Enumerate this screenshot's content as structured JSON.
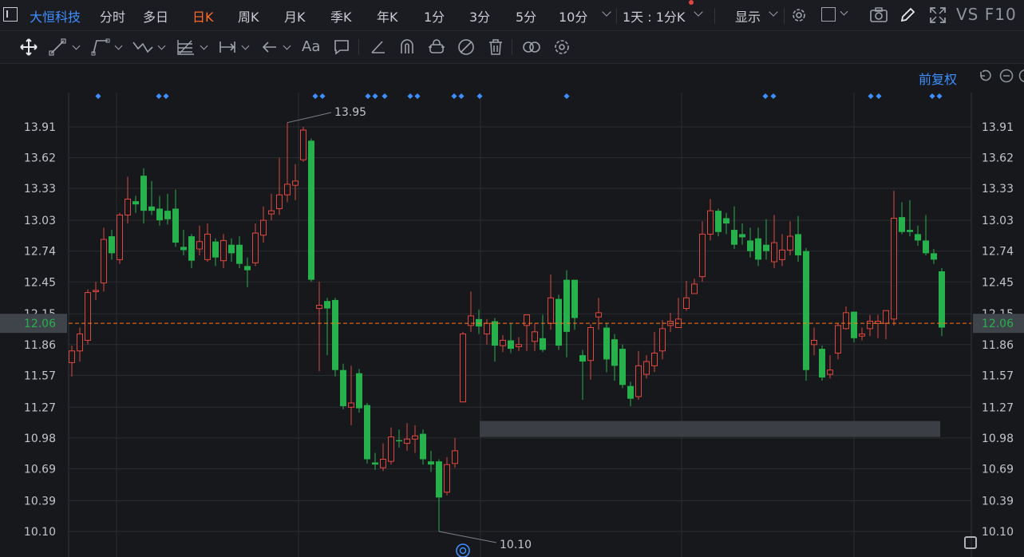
{
  "app": {
    "title": "大恒科技"
  },
  "topbar": {
    "menu_icon": "menu-square-icon",
    "periods": [
      "分时",
      "多日",
      "日K",
      "周K",
      "月K",
      "季K",
      "年K",
      "1分",
      "3分",
      "5分",
      "10分"
    ],
    "active_period": "日K",
    "more_chevron": "chevron-down-icon",
    "range_label": "1天 : 1分K",
    "display_label": "显示",
    "right_text": "VS F10"
  },
  "toolbar": {
    "tools": [
      "move-icon",
      "line-icon",
      "channel-icon",
      "wave-icon",
      "fib-icon",
      "measure-icon",
      "arrow-icon",
      "text-icon",
      "note-icon",
      "angle-icon",
      "magnet-icon",
      "lock-icon",
      "hide-icon",
      "delete-icon",
      "link-icon",
      "settings-icon"
    ],
    "text_tool_label": "Aa"
  },
  "chart_header": {
    "adjust_label": "前复权"
  },
  "colors": {
    "up": "#e0473f",
    "down": "#27b14c",
    "accent": "#3e8fff",
    "bg": "#17181c",
    "grid": "#2a2c31"
  },
  "chart_data": {
    "type": "candlestick",
    "y_ticks": [
      "13.91",
      "13.62",
      "13.33",
      "13.03",
      "12.74",
      "12.45",
      "12.15",
      "11.86",
      "11.57",
      "11.27",
      "10.98",
      "10.69",
      "10.39",
      "10.10"
    ],
    "y_tick_values": [
      13.91,
      13.62,
      13.33,
      13.03,
      12.74,
      12.45,
      12.15,
      11.86,
      11.57,
      11.27,
      10.98,
      10.69,
      10.39,
      10.1
    ],
    "ylim": [
      10.1,
      13.91
    ],
    "current_price": "12.06",
    "current_price_value": 12.06,
    "high_label": "13.95",
    "high_value": 13.95,
    "low_label": "10.10",
    "low_value": 10.1,
    "candles": [
      [
        11.69,
        11.8,
        11.56,
        11.85
      ],
      [
        11.8,
        11.96,
        11.7,
        12.02
      ],
      [
        11.9,
        12.35,
        11.86,
        12.38
      ],
      [
        12.36,
        12.37,
        12.28,
        12.45
      ],
      [
        12.44,
        12.85,
        12.36,
        12.96
      ],
      [
        12.88,
        12.72,
        12.66,
        12.94
      ],
      [
        12.66,
        13.08,
        12.62,
        13.1
      ],
      [
        13.08,
        13.23,
        13.0,
        13.44
      ],
      [
        13.21,
        13.18,
        13.1,
        13.26
      ],
      [
        13.45,
        13.12,
        13.0,
        13.52
      ],
      [
        13.16,
        13.12,
        13.08,
        13.4
      ],
      [
        13.14,
        13.03,
        12.98,
        13.26
      ],
      [
        13.12,
        13.04,
        12.99,
        13.28
      ],
      [
        13.14,
        12.82,
        12.78,
        13.32
      ],
      [
        12.78,
        12.75,
        12.7,
        12.94
      ],
      [
        12.88,
        12.65,
        12.58,
        12.9
      ],
      [
        12.76,
        12.83,
        12.7,
        12.98
      ],
      [
        12.66,
        12.9,
        12.64,
        13.0
      ],
      [
        12.83,
        12.68,
        12.6,
        12.86
      ],
      [
        12.65,
        12.84,
        12.58,
        12.9
      ],
      [
        12.8,
        12.72,
        12.64,
        12.86
      ],
      [
        12.8,
        12.62,
        12.58,
        12.88
      ],
      [
        12.6,
        12.56,
        12.4,
        12.68
      ],
      [
        12.63,
        12.91,
        12.6,
        13.0
      ],
      [
        12.89,
        13.03,
        12.82,
        13.16
      ],
      [
        13.09,
        13.12,
        13.03,
        13.28
      ],
      [
        13.14,
        13.27,
        13.08,
        13.62
      ],
      [
        13.27,
        13.37,
        13.2,
        13.95
      ],
      [
        13.36,
        13.4,
        13.22,
        13.56
      ],
      [
        13.6,
        13.88,
        13.58,
        13.91
      ],
      [
        13.78,
        12.47,
        12.45,
        13.8
      ],
      [
        12.2,
        12.23,
        11.61,
        12.45
      ],
      [
        12.27,
        12.2,
        11.76,
        12.3
      ],
      [
        12.28,
        11.62,
        11.56,
        12.3
      ],
      [
        11.62,
        11.28,
        11.25,
        11.68
      ],
      [
        11.27,
        11.31,
        11.1,
        11.66
      ],
      [
        11.59,
        11.26,
        11.22,
        11.63
      ],
      [
        11.29,
        10.78,
        10.74,
        11.31
      ],
      [
        10.75,
        10.73,
        10.68,
        10.84
      ],
      [
        10.7,
        10.78,
        10.67,
        10.93
      ],
      [
        10.76,
        10.99,
        10.73,
        11.08
      ],
      [
        10.96,
        10.95,
        10.89,
        11.06
      ],
      [
        10.93,
        10.97,
        10.86,
        11.12
      ],
      [
        10.97,
        11.0,
        10.84,
        11.1
      ],
      [
        11.02,
        10.78,
        10.73,
        11.06
      ],
      [
        10.76,
        10.73,
        10.66,
        10.86
      ],
      [
        10.76,
        10.42,
        10.1,
        10.78
      ],
      [
        10.47,
        10.73,
        10.44,
        10.8
      ],
      [
        10.74,
        10.86,
        10.7,
        10.98
      ],
      [
        11.32,
        11.96,
        11.32,
        11.98
      ],
      [
        12.04,
        12.13,
        11.98,
        12.36
      ],
      [
        12.1,
        12.03,
        11.96,
        12.19
      ],
      [
        11.96,
        12.06,
        11.86,
        12.1
      ],
      [
        12.08,
        11.85,
        11.7,
        12.11
      ],
      [
        11.85,
        11.9,
        11.79,
        11.95
      ],
      [
        11.9,
        11.82,
        11.78,
        12.06
      ],
      [
        11.84,
        11.86,
        11.8,
        11.93
      ],
      [
        12.04,
        12.14,
        11.8,
        12.1
      ],
      [
        11.89,
        11.98,
        11.8,
        12.06
      ],
      [
        11.92,
        11.81,
        11.79,
        12.14
      ],
      [
        12.06,
        12.3,
        12.0,
        12.52
      ],
      [
        12.29,
        11.85,
        11.81,
        12.33
      ],
      [
        12.47,
        11.98,
        11.74,
        12.56
      ],
      [
        12.47,
        12.11,
        12.0,
        12.45
      ],
      [
        11.76,
        11.7,
        11.34,
        11.81
      ],
      [
        11.71,
        12.02,
        11.53,
        12.05
      ],
      [
        12.12,
        12.16,
        12.0,
        12.3
      ],
      [
        12.02,
        11.72,
        11.6,
        12.06
      ],
      [
        11.91,
        11.66,
        11.52,
        11.96
      ],
      [
        11.82,
        11.48,
        11.45,
        11.86
      ],
      [
        11.47,
        11.35,
        11.28,
        11.51
      ],
      [
        11.37,
        11.66,
        11.34,
        11.8
      ],
      [
        11.58,
        11.7,
        11.54,
        11.76
      ],
      [
        11.66,
        11.78,
        11.6,
        11.98
      ],
      [
        11.8,
        12.01,
        11.72,
        12.09
      ],
      [
        12.04,
        12.08,
        11.98,
        12.16
      ],
      [
        12.02,
        12.1,
        12.04,
        12.3
      ],
      [
        12.2,
        12.3,
        12.18,
        12.46
      ],
      [
        12.34,
        12.43,
        12.34,
        12.48
      ],
      [
        12.5,
        12.9,
        12.45,
        13.02
      ],
      [
        12.9,
        13.12,
        12.84,
        13.23
      ],
      [
        13.12,
        12.92,
        12.88,
        13.14
      ],
      [
        13.05,
        13.0,
        12.9,
        13.1
      ],
      [
        12.94,
        12.8,
        12.76,
        13.16
      ],
      [
        12.9,
        12.87,
        12.8,
        13.0
      ],
      [
        12.84,
        12.74,
        12.68,
        12.96
      ],
      [
        12.86,
        12.66,
        12.6,
        12.96
      ],
      [
        12.8,
        12.74,
        12.66,
        13.04
      ],
      [
        12.64,
        12.82,
        12.58,
        13.08
      ],
      [
        12.66,
        12.75,
        12.6,
        12.9
      ],
      [
        12.75,
        12.88,
        12.7,
        13.02
      ],
      [
        12.9,
        12.7,
        12.64,
        13.07
      ],
      [
        12.74,
        11.62,
        11.52,
        12.77
      ],
      [
        11.86,
        11.9,
        11.76,
        12.02
      ],
      [
        11.82,
        11.55,
        11.52,
        11.85
      ],
      [
        11.58,
        11.62,
        11.54,
        11.76
      ],
      [
        11.78,
        12.04,
        11.72,
        12.06
      ],
      [
        12.01,
        12.16,
        12.0,
        12.22
      ],
      [
        12.17,
        11.92,
        11.88,
        12.14
      ],
      [
        11.94,
        11.96,
        11.9,
        12.02
      ],
      [
        12.01,
        12.08,
        11.94,
        12.14
      ],
      [
        12.06,
        12.08,
        11.92,
        12.14
      ],
      [
        12.06,
        12.18,
        11.91,
        12.1
      ],
      [
        12.1,
        13.05,
        12.04,
        13.31
      ],
      [
        13.06,
        12.92,
        12.9,
        13.2
      ],
      [
        12.94,
        12.92,
        12.88,
        13.22
      ],
      [
        12.9,
        12.84,
        12.79,
        12.98
      ],
      [
        12.84,
        12.72,
        12.7,
        13.08
      ],
      [
        12.72,
        12.66,
        12.62,
        12.76
      ],
      [
        12.55,
        12.02,
        11.94,
        12.58
      ]
    ],
    "gap_band": {
      "from": 10.99,
      "to": 11.14
    },
    "event_markers_count": 16
  }
}
